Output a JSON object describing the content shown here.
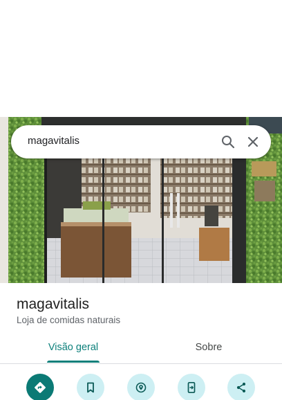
{
  "search": {
    "query": "magavitalis"
  },
  "place": {
    "name": "magavitalis",
    "category": "Loja de comidas naturais"
  },
  "tabs": [
    {
      "label": "Visão geral",
      "selected": true
    },
    {
      "label": "Sobre",
      "selected": false
    }
  ],
  "actions": [
    {
      "icon": "directions-icon",
      "style": "primary"
    },
    {
      "icon": "save-bookmark-icon",
      "style": "tonal"
    },
    {
      "icon": "nearby-icon",
      "style": "tonal"
    },
    {
      "icon": "send-to-phone-icon",
      "style": "tonal"
    },
    {
      "icon": "share-icon",
      "style": "tonal"
    }
  ],
  "colors": {
    "accent": "#0b7f7a",
    "action_primary": "#0b7a75",
    "action_tonal": "#cdeff3"
  }
}
